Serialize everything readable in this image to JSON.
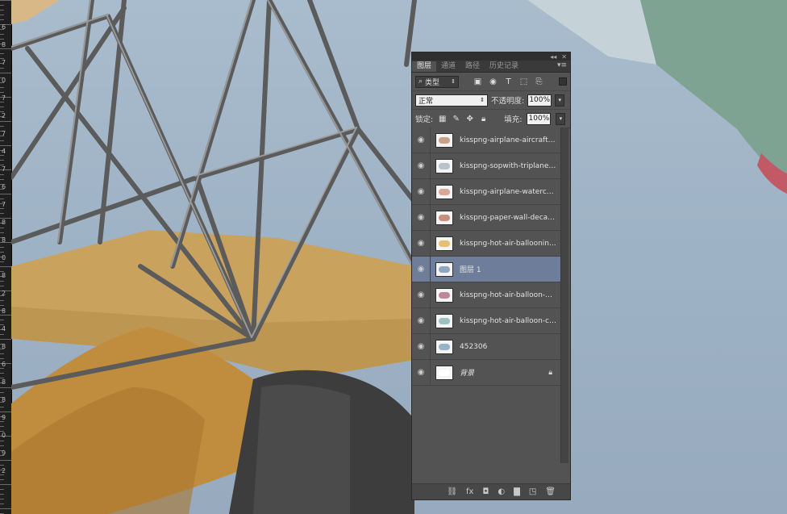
{
  "ruler": {
    "numbers": [
      "6",
      "8",
      "7",
      "0",
      "7",
      "2",
      "7",
      "4",
      "7",
      "6",
      "7",
      "8",
      "8",
      "0",
      "8",
      "2",
      "8",
      "4",
      "8",
      "6",
      "8",
      "8",
      "9",
      "0",
      "9",
      "2"
    ]
  },
  "panel": {
    "top_buttons": [
      "◂◂",
      "✕"
    ],
    "tabs": [
      {
        "label": "图层",
        "active": true
      },
      {
        "label": "通道",
        "active": false
      },
      {
        "label": "路径",
        "active": false
      },
      {
        "label": "历史记录",
        "active": false
      }
    ],
    "menu_icon": "panel-menu-icon",
    "filter": {
      "label": "类型",
      "icon": "search-icon"
    },
    "filter_icons": [
      "image-filter-icon",
      "adjustment-filter-icon",
      "text-filter-icon",
      "shape-filter-icon",
      "smart-object-filter-icon"
    ],
    "blend_mode": "正常",
    "opacity_label": "不透明度:",
    "opacity_value": "100%",
    "lock_label": "锁定:",
    "lock_icons": [
      "lock-transparent-pixels-icon",
      "lock-image-pixels-icon",
      "lock-position-icon",
      "lock-all-icon"
    ],
    "fill_label": "填充:",
    "fill_value": "100%",
    "layers": [
      {
        "name": "kisspng-airplane-aircraft-...",
        "selected": false,
        "italic": false,
        "locked": false,
        "thumb_color": "#c9a08a"
      },
      {
        "name": "kisspng-sopwith-triplane-...",
        "selected": false,
        "italic": false,
        "locked": false,
        "thumb_color": "#b8c2cc"
      },
      {
        "name": "kisspng-airplane-waterco...",
        "selected": false,
        "italic": false,
        "locked": false,
        "thumb_color": "#d8a79a"
      },
      {
        "name": "kisspng-paper-wall-decal...",
        "selected": false,
        "italic": false,
        "locked": false,
        "thumb_color": "#c88f80"
      },
      {
        "name": "kisspng-hot-air-balloonin...",
        "selected": false,
        "italic": false,
        "locked": false,
        "thumb_color": "#e6c070"
      },
      {
        "name": "图层 1",
        "selected": true,
        "italic": false,
        "locked": false,
        "thumb_color": "#8fa6be"
      },
      {
        "name": "kisspng-hot-air-balloon-bl...",
        "selected": false,
        "italic": false,
        "locked": false,
        "thumb_color": "#c0879a"
      },
      {
        "name": "kisspng-hot-air-balloon-ca...",
        "selected": false,
        "italic": false,
        "locked": false,
        "thumb_color": "#9fc0c2"
      },
      {
        "name": "452306",
        "selected": false,
        "italic": false,
        "locked": false,
        "thumb_color": "#9ab2c8"
      },
      {
        "name": "背景",
        "selected": false,
        "italic": true,
        "locked": true,
        "thumb_color": "#ffffff"
      }
    ],
    "bottom_icons": [
      "link-layers-icon",
      "fx-icon",
      "add-mask-icon",
      "adjustment-layer-icon",
      "new-group-icon",
      "new-layer-icon",
      "delete-layer-icon"
    ],
    "bottom_glyphs": [
      "⛓",
      "fx",
      "◘",
      "◐",
      "▇",
      "◳",
      "🗑"
    ]
  }
}
